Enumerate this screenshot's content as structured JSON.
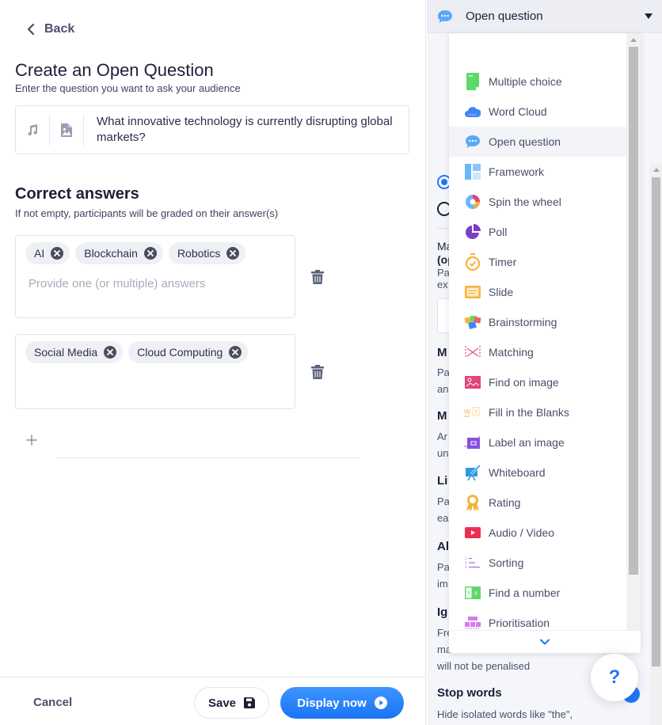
{
  "editor": {
    "back_label": "Back",
    "title": "Create an Open Question",
    "subtitle": "Enter the question you want to ask your audience",
    "question_text": "What innovative technology is currently disrupting global markets?",
    "correct_answers": {
      "heading": "Correct answers",
      "description": "If not empty, participants will be graded on their answer(s)",
      "input_placeholder": "Provide one (or multiple) answers",
      "groups": [
        {
          "chips": [
            "AI",
            "Blockchain",
            "Robotics"
          ],
          "show_placeholder": true
        },
        {
          "chips": [
            "Social Media",
            "Cloud Computing"
          ],
          "show_placeholder": false
        }
      ]
    }
  },
  "footer": {
    "cancel_label": "Cancel",
    "save_label": "Save",
    "display_label": "Display now"
  },
  "question_type": {
    "selected": "Open question",
    "options": [
      {
        "label": "Multiple choice",
        "icon": "multiple-choice-icon",
        "color": "#5fd86a"
      },
      {
        "label": "Word Cloud",
        "icon": "word-cloud-icon",
        "color": "#3f86f2"
      },
      {
        "label": "Open question",
        "icon": "open-question-icon",
        "color": "#5aa8f5",
        "active": true
      },
      {
        "label": "Framework",
        "icon": "framework-icon",
        "color": "#6bb6f6"
      },
      {
        "label": "Spin the wheel",
        "icon": "spin-wheel-icon",
        "color": "#e0457b"
      },
      {
        "label": "Poll",
        "icon": "poll-icon",
        "color": "#7a3fc4"
      },
      {
        "label": "Timer",
        "icon": "timer-icon",
        "color": "#f6b23c"
      },
      {
        "label": "Slide",
        "icon": "slide-icon",
        "color": "#f6b23c"
      },
      {
        "label": "Brainstorming",
        "icon": "brainstorming-icon",
        "color": "#f05d5d"
      },
      {
        "label": "Matching",
        "icon": "matching-icon",
        "color": "#e8587e"
      },
      {
        "label": "Find on image",
        "icon": "find-on-image-icon",
        "color": "#e0457b"
      },
      {
        "label": "Fill in the Blanks",
        "icon": "fill-blanks-icon",
        "color": "#f6b23c"
      },
      {
        "label": "Label an image",
        "icon": "label-image-icon",
        "color": "#8a4fe0"
      },
      {
        "label": "Whiteboard",
        "icon": "whiteboard-icon",
        "color": "#2e9bdf"
      },
      {
        "label": "Rating",
        "icon": "rating-icon",
        "color": "#f6b23c"
      },
      {
        "label": "Audio / Video",
        "icon": "audio-video-icon",
        "color": "#ee2d52"
      },
      {
        "label": "Sorting",
        "icon": "sorting-icon",
        "color": "#a271e8"
      },
      {
        "label": "Find a number",
        "icon": "find-number-icon",
        "color": "#5fd86a"
      },
      {
        "label": "Prioritisation",
        "icon": "prioritisation-icon",
        "color": "#d77af0"
      }
    ]
  },
  "settings": {
    "partial_labels": {
      "max_label_1": "Ma",
      "max_label_2": "(op",
      "max_desc_1": "Pa",
      "max_desc_2": "ex",
      "multiple_head": "M",
      "multiple_desc_1": "Pa",
      "multiple_desc_2": "an",
      "moderation_head": "M",
      "moderation_desc_1": "Ar",
      "moderation_desc_2": "un",
      "likes_head": "Li",
      "likes_desc_1": "Pa",
      "likes_desc_2": "ea",
      "allow_head": "Al",
      "allow_desc_1": "Pa",
      "allow_desc_2": "im",
      "ignore_head": "Ig",
      "ignore_desc_1": "Fre",
      "ignore_desc_2": "ma"
    },
    "ignore_desc_end": "will not be penalised",
    "stop_words_head": "Stop words",
    "stop_words_desc": "Hide isolated words like \"the\","
  },
  "help": {
    "label": "?"
  },
  "colors": {
    "accent": "#1e78f7",
    "text_dark": "#1d1f3a",
    "chip_bg": "#eef0f4"
  }
}
